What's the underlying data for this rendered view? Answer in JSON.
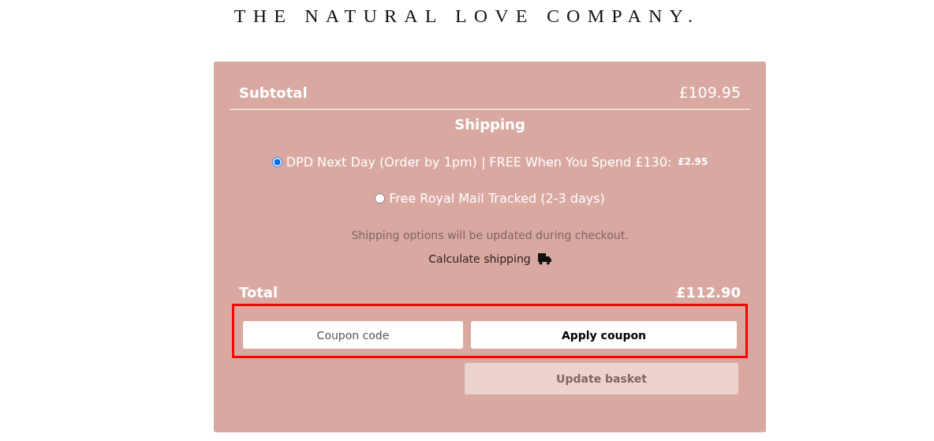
{
  "header": {
    "logo": "THE NATURAL LOVE COMPANY."
  },
  "subtotal": {
    "label": "Subtotal",
    "value": "£109.95"
  },
  "shipping": {
    "title": "Shipping",
    "options": [
      {
        "label": "DPD Next Day (Order by 1pm) | FREE When You Spend £130:",
        "price": "£2.95",
        "selected": true
      },
      {
        "label": "Free Royal Mail Tracked (2-3 days)",
        "selected": false
      }
    ],
    "note": "Shipping options will be updated during checkout.",
    "calculate_link": "Calculate shipping"
  },
  "total": {
    "label": "Total",
    "value": "£112.90"
  },
  "coupon": {
    "placeholder": "Coupon code",
    "button": "Apply coupon",
    "highlighted": true
  },
  "update_button": {
    "label": "Update basket",
    "disabled": true
  }
}
